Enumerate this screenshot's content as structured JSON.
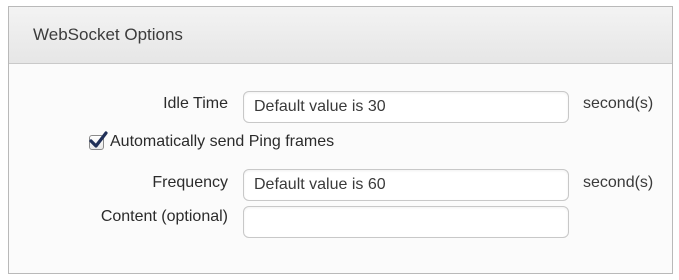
{
  "panel": {
    "title": "WebSocket Options"
  },
  "idle_time": {
    "label": "Idle Time",
    "placeholder": "Default value is 30",
    "value": "",
    "unit": "second(s)"
  },
  "auto_ping": {
    "label": "Automatically send Ping frames",
    "checked": true
  },
  "frequency": {
    "label": "Frequency",
    "placeholder": "Default value is 60",
    "value": "",
    "unit": "second(s)"
  },
  "content": {
    "label": "Content (optional)",
    "placeholder": "",
    "value": ""
  },
  "icons": {
    "checkbox_check": "checkmark-icon"
  },
  "colors": {
    "checkmark": "#1f2f57",
    "header_bg": "#ececec",
    "border": "#b9b9b9"
  }
}
